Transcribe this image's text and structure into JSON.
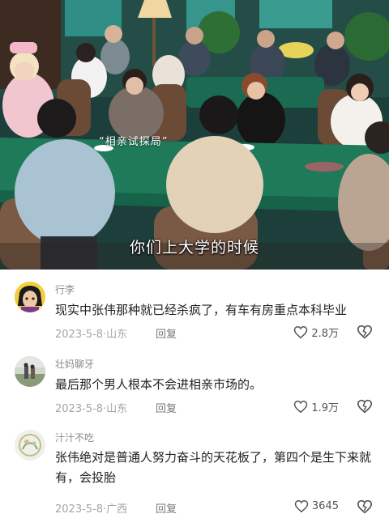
{
  "video": {
    "tag": "“相亲试探局”",
    "subtitle": "你们上大学的时候"
  },
  "comments": [
    {
      "username": "行李",
      "text": "现实中张伟那种就已经杀疯了，有车有房重点本科毕业",
      "date": "2023-5-8",
      "location": "山东",
      "reply_label": "回复",
      "likes": "2.8万"
    },
    {
      "username": "壮妈聊牙",
      "text": "最后那个男人根本不会进相亲市场的。",
      "date": "2023-5-8",
      "location": "山东",
      "reply_label": "回复",
      "likes": "1.9万"
    },
    {
      "username": "汁汁不吃",
      "text": "张伟绝对是普通人努力奋斗的天花板了，第四个是生下来就有，会投胎",
      "date": "2023-5-8",
      "location": "广西",
      "reply_label": "回复",
      "likes": "3645"
    }
  ],
  "colors": {
    "table_green": "#1f7a5a",
    "meta_gray": "#a5a5a5",
    "text": "#222222"
  },
  "icons": [
    "heart-outline-icon",
    "broken-heart-icon"
  ]
}
